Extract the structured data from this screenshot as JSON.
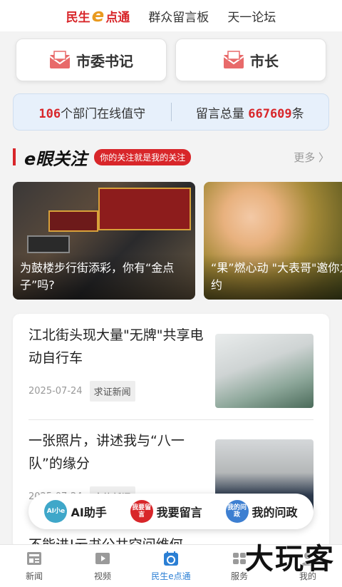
{
  "topnav": {
    "logo_text_pre": "民生",
    "logo_text_e": "e",
    "logo_text_post": "点通",
    "link_board": "群众留言板",
    "link_forum": "天一论坛"
  },
  "leaders": [
    {
      "label": "市委书记"
    },
    {
      "label": "市长"
    }
  ],
  "stats": {
    "departments_count": "106",
    "departments_suffix": "个部门在线值守",
    "messages_prefix": "留言总量",
    "messages_count": "667609",
    "messages_suffix": "条"
  },
  "section": {
    "title": "e眼关注",
    "badge": "你的关注就是我的关注",
    "more": "更多 〉"
  },
  "featured": [
    {
      "caption": "为鼓楼步行街添彩，你有“金点子”吗?"
    },
    {
      "caption": "“果”燃心动 \"大表哥\"邀你之约"
    }
  ],
  "news": [
    {
      "title": "江北街头现大量\"无牌\"共享电动自行车",
      "date": "2025-07-24",
      "tag": "求证新闻"
    },
    {
      "title": "一张照片，讲述我与“八一队”的缘分",
      "date": "2025-07-24",
      "tag": "文旅新闻"
    },
    {
      "title": "不能进!云书公共空间维何"
    }
  ],
  "float_bar": {
    "ai_label": "AI助手",
    "ai_icon_text": "AI小e",
    "leave_label": "我要留言",
    "leave_icon_text": "我要留言",
    "ask_label": "我的问政",
    "ask_icon_text": "我的问政"
  },
  "tabbar": [
    {
      "label": "新闻",
      "icon": "newspaper-icon"
    },
    {
      "label": "视频",
      "icon": "video-icon"
    },
    {
      "label": "民生e点通",
      "icon": "calendar-icon",
      "active": true
    },
    {
      "label": "服务",
      "icon": "service-icon"
    },
    {
      "label": "我的",
      "icon": "profile-icon"
    }
  ],
  "watermark": "大玩客",
  "colors": {
    "accent": "#d8262a",
    "active_tab": "#2b7fd4",
    "stats_bg": "#e7f0fb"
  }
}
